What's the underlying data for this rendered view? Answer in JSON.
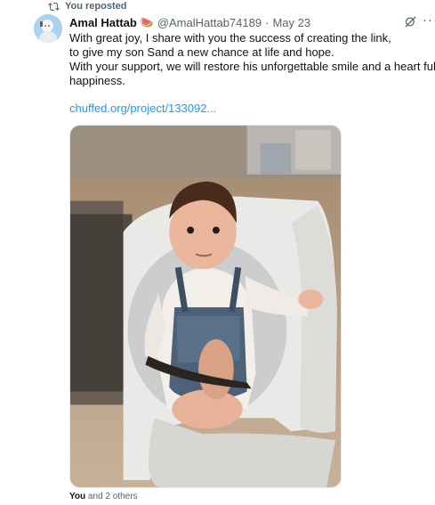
{
  "repost": {
    "label": "You reposted"
  },
  "post": {
    "author_name": "Amal Hattab",
    "author_emoji": "🍉",
    "handle": "@AmalHattab74189",
    "separator": "·",
    "date": "May 23",
    "lines": [
      "With great joy, I share with you the success of creating the link,",
      "to give my son Sand a new chance at life and hope.",
      "With your support, we will restore his unforgettable smile and a heart full of",
      "happiness."
    ],
    "link": "chuffed.org/project/133092...",
    "media_icon": "photo-toddler-in-chair"
  },
  "likes": {
    "you": "You",
    "rest": " and 2 others"
  },
  "icons": {
    "repost": "repost-icon",
    "grok": "grok-icon",
    "more": "more-icon"
  },
  "colors": {
    "accent": "#1d9bf0",
    "muted": "#536471",
    "text": "#0f1419"
  }
}
